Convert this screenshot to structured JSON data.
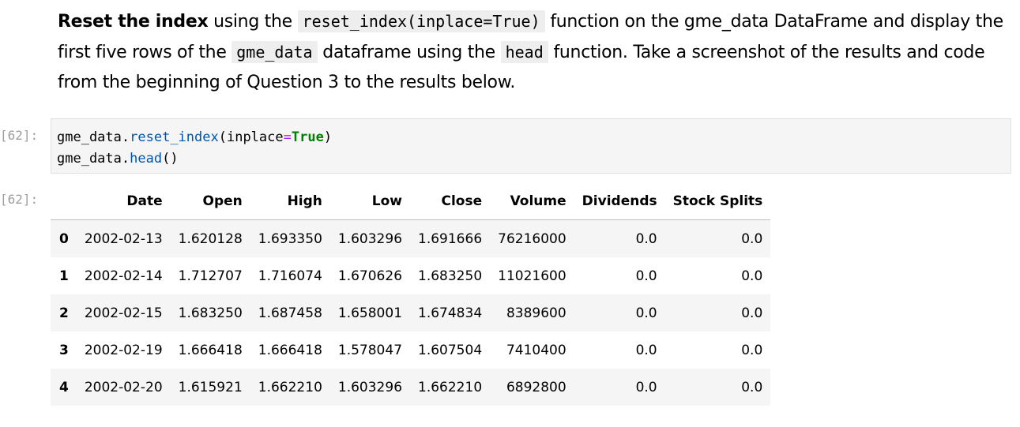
{
  "markdown": {
    "bold_lead": "Reset the index",
    "t1": " using the ",
    "code1": "reset_index(inplace=True)",
    "t2": " function on the gme_data DataFrame and display the first five rows of the ",
    "code2": "gme_data",
    "t3": " dataframe using the ",
    "code3": "head",
    "t4": " function. Take a screenshot of the results and code from the beginning of Question 3 to the results below."
  },
  "cell": {
    "in_prompt": "[62]:",
    "out_prompt": "[62]:",
    "line1": {
      "obj": "gme_data",
      "dot": ".",
      "fn": "reset_index",
      "open": "(inplace",
      "eq": "=",
      "kw": "True",
      "close": ")"
    },
    "line2": {
      "obj": "gme_data",
      "dot": ".",
      "fn": "head",
      "parens": "()"
    }
  },
  "table": {
    "columns": [
      "",
      "Date",
      "Open",
      "High",
      "Low",
      "Close",
      "Volume",
      "Dividends",
      "Stock Splits"
    ],
    "rows": [
      [
        "0",
        "2002-02-13",
        "1.620128",
        "1.693350",
        "1.603296",
        "1.691666",
        "76216000",
        "0.0",
        "0.0"
      ],
      [
        "1",
        "2002-02-14",
        "1.712707",
        "1.716074",
        "1.670626",
        "1.683250",
        "11021600",
        "0.0",
        "0.0"
      ],
      [
        "2",
        "2002-02-15",
        "1.683250",
        "1.687458",
        "1.658001",
        "1.674834",
        "8389600",
        "0.0",
        "0.0"
      ],
      [
        "3",
        "2002-02-19",
        "1.666418",
        "1.666418",
        "1.578047",
        "1.607504",
        "7410400",
        "0.0",
        "0.0"
      ],
      [
        "4",
        "2002-02-20",
        "1.615921",
        "1.662210",
        "1.603296",
        "1.662210",
        "6892800",
        "0.0",
        "0.0"
      ]
    ]
  }
}
